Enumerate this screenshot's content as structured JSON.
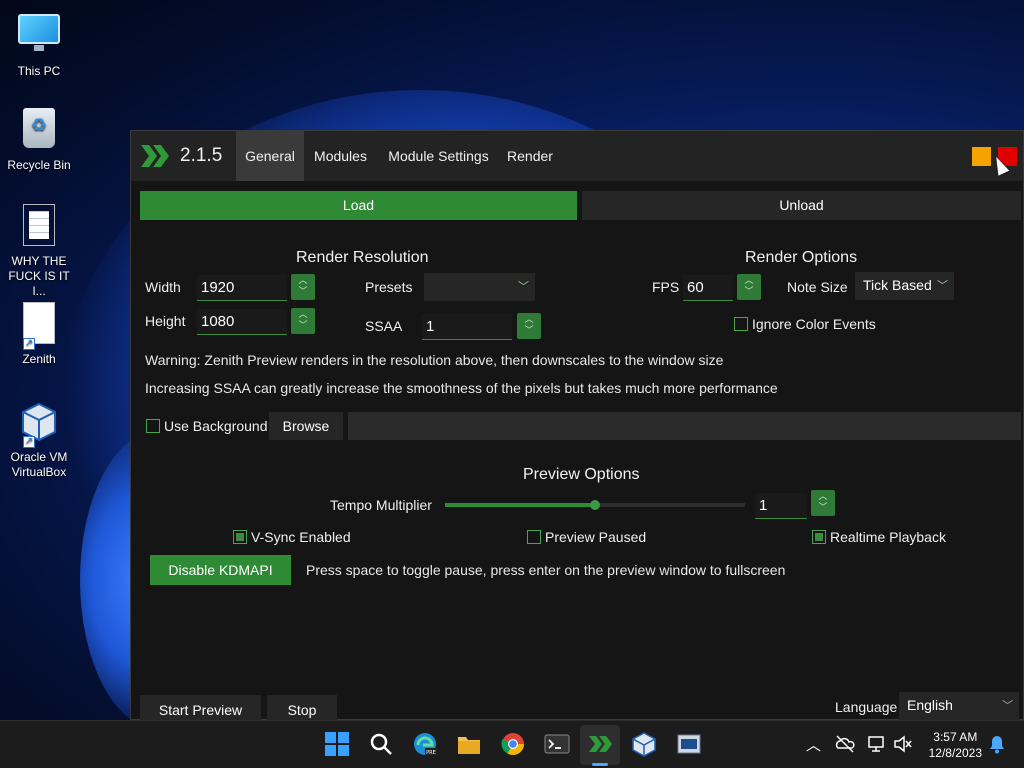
{
  "desktop": {
    "icons": [
      {
        "label": "This PC"
      },
      {
        "label": "Recycle Bin"
      },
      {
        "label": "WHY THE FUCK IS IT I..."
      },
      {
        "label": "Zenith"
      },
      {
        "label": "Oracle VM VirtualBox"
      }
    ]
  },
  "app": {
    "version": "2.1.5",
    "tabs": [
      {
        "label": "General",
        "active": true
      },
      {
        "label": "Modules"
      },
      {
        "label": "Module Settings"
      },
      {
        "label": "Render"
      }
    ],
    "window_buttons": {
      "minimize_color": "#f5a300",
      "close_color": "#e00000"
    },
    "load_label": "Load",
    "unload_label": "Unload",
    "render_resolution": {
      "title": "Render Resolution",
      "width_label": "Width",
      "width_value": "1920",
      "height_label": "Height",
      "height_value": "1080",
      "presets_label": "Presets",
      "presets_value": "",
      "ssaa_label": "SSAA",
      "ssaa_value": "1"
    },
    "render_options": {
      "title": "Render Options",
      "fps_label": "FPS",
      "fps_value": "60",
      "note_size_label": "Note Size",
      "note_size_value": "Tick Based",
      "ignore_color_events_label": "Ignore Color Events",
      "ignore_color_events_checked": false
    },
    "warning_text": "Warning: Zenith Preview renders in the resolution above, then downscales to the window size",
    "ssaa_text": "Increasing SSAA can greatly increase the smoothness of the pixels but takes much more performance",
    "background": {
      "use_background_label": "Use Background",
      "use_background_checked": false,
      "browse_label": "Browse",
      "path_value": ""
    },
    "preview_options": {
      "title": "Preview Options",
      "tempo_label": "Tempo Multiplier",
      "tempo_value": "1",
      "tempo_slider_fraction": 0.5,
      "vsync_label": "V-Sync Enabled",
      "vsync_checked": true,
      "paused_label": "Preview Paused",
      "paused_checked": false,
      "realtime_label": "Realtime Playback",
      "realtime_checked": true
    },
    "kdmapi_label": "Disable KDMAPI",
    "kdmapi_hint": "Press space to toggle pause, press enter on the preview window to fullscreen",
    "start_preview_label": "Start Preview",
    "stop_label": "Stop",
    "language_label": "Language",
    "language_value": "English",
    "accent_color": "#2f8a35"
  },
  "taskbar": {
    "time": "3:57 AM",
    "date": "12/8/2023"
  }
}
